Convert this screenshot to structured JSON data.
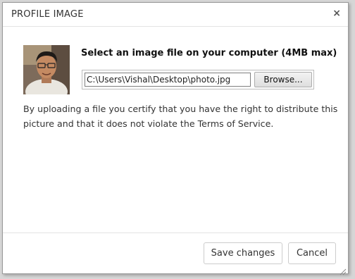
{
  "dialog": {
    "title": "PROFILE IMAGE",
    "close_glyph": "×",
    "prompt": "Select an image file on your computer (4MB max)",
    "file_path": "C:\\Users\\Vishal\\Desktop\\photo.jpg",
    "browse_label": "Browse...",
    "disclaimer": "By uploading a file you certify that you have the right to distribute this picture and that it does not violate the Terms of Service."
  },
  "footer": {
    "save_label": "Save changes",
    "cancel_label": "Cancel"
  },
  "icons": {
    "close": "close-icon",
    "resize": "resize-grip-icon"
  }
}
